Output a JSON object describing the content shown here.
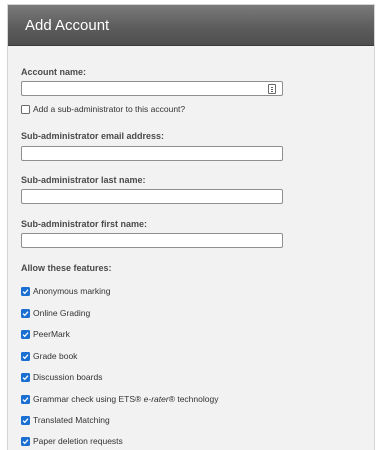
{
  "dialog": {
    "title": "Add Account"
  },
  "account_name": {
    "label": "Account name:",
    "value": ""
  },
  "sub_admin_checkbox": {
    "label": "Add a sub-administrator to this account?",
    "checked": false
  },
  "sub_admin_email": {
    "label": "Sub-administrator email address:",
    "value": ""
  },
  "sub_admin_last_name": {
    "label": "Sub-administrator last name:",
    "value": ""
  },
  "sub_admin_first_name": {
    "label": "Sub-administrator first name:",
    "value": ""
  },
  "features": {
    "heading": "Allow these features:",
    "items": [
      {
        "label": "Anonymous marking",
        "checked": true
      },
      {
        "label": "Online Grading",
        "checked": true
      },
      {
        "label": "PeerMark",
        "checked": true
      },
      {
        "label": "Grade book",
        "checked": true
      },
      {
        "label": "Discussion boards",
        "checked": true
      },
      {
        "label_before": "Grammar check using ETS® ",
        "label_italic": "e-rater",
        "label_after": "® technology",
        "checked": true
      },
      {
        "label": "Translated Matching",
        "checked": true
      },
      {
        "label": "Paper deletion requests",
        "checked": true
      }
    ]
  },
  "colors": {
    "titlebar": "#5d5d5d",
    "panel_bg": "#f2f2f2",
    "checkbox_checked": "#1a6fd1"
  }
}
